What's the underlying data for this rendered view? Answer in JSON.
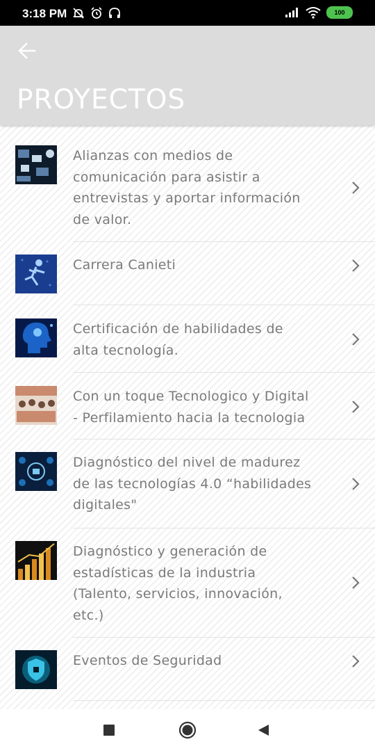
{
  "status_bar": {
    "time": "3:18 PM",
    "battery": "100",
    "icons": [
      "mute-icon",
      "alarm-icon",
      "headphones-icon",
      "signal-icon",
      "wifi-icon",
      "battery-icon"
    ]
  },
  "header": {
    "back_icon": "arrow-left-icon",
    "title": "PROYECTOS"
  },
  "projects": [
    {
      "title_lines": [
        "Alianzas con medios de",
        "comunicación para asistir a",
        "entrevistas y aportar información",
        "de valor."
      ],
      "thumbnail": "media-network-thumbnail",
      "colors": [
        "#0d1b2a",
        "#5a7fa8",
        "#c9dbe8"
      ]
    },
    {
      "title_lines": [
        "Carrera Canieti"
      ],
      "thumbnail": "digital-runner-thumbnail",
      "colors": [
        "#1a3d8f",
        "#4a86d8",
        "#a9d2ff"
      ]
    },
    {
      "title_lines": [
        "Certificación de habilidades de",
        "alta tecnología."
      ],
      "thumbnail": "ai-head-thumbnail",
      "colors": [
        "#061a4a",
        "#1b63c6",
        "#7fc6ff"
      ]
    },
    {
      "title_lines": [
        "Con un toque Tecnologico y Digital",
        "- Perfilamiento hacia la tecnologia"
      ],
      "thumbnail": "classroom-photo-thumbnail",
      "colors": [
        "#6e4b3a",
        "#c98a6e",
        "#e8d8cc"
      ]
    },
    {
      "title_lines": [
        "Diagnóstico del nivel de madurez",
        "de las tecnologías 4.0 “habilidades",
        "digitales\""
      ],
      "thumbnail": "tech-icons-thumbnail",
      "colors": [
        "#0a1f3d",
        "#1d6fb8",
        "#7ec8f0"
      ]
    },
    {
      "title_lines": [
        "Diagnóstico y generación de",
        "estadísticas de la industria",
        "(Talento, servicios, innovación,",
        "etc.)"
      ],
      "thumbnail": "bar-chart-thumbnail",
      "colors": [
        "#101010",
        "#d98a1e",
        "#f2c14e"
      ]
    },
    {
      "title_lines": [
        "Eventos de Seguridad"
      ],
      "thumbnail": "security-shield-thumbnail",
      "colors": [
        "#041c2c",
        "#0b5f7a",
        "#39c3e6"
      ]
    }
  ],
  "nav_bar": {
    "icons": [
      "recents-square-icon",
      "home-circle-icon",
      "back-triangle-icon"
    ]
  }
}
